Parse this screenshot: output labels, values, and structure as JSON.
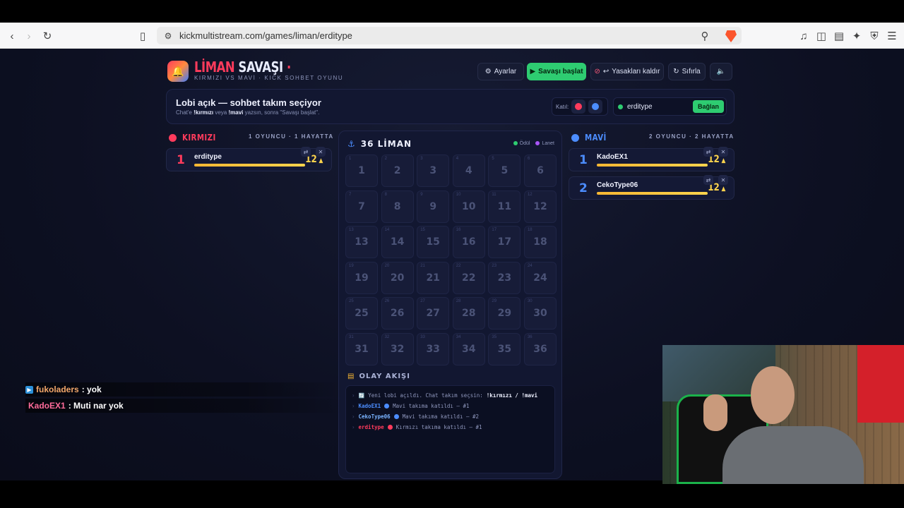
{
  "browser": {
    "url": "kickmultistream.com/games/liman/erditype"
  },
  "header": {
    "logo_red": "LİMAN",
    "logo_white": "SAVAŞI",
    "logo_dot": "·",
    "subtitle": "KIRMIZI VS MAVİ · KICK SOHBET OYUNU",
    "buttons": {
      "settings": "Ayarlar",
      "start": "Savaşı başlat",
      "unban": "Yasakları kaldır",
      "reset": "Sıfırla"
    }
  },
  "lobby": {
    "title": "Lobi açık — sohbet takım seçiyor",
    "sub_prefix": "Chat'e ",
    "sub_red": "!kırmızı",
    "sub_mid": " veya ",
    "sub_blue": "!mavi",
    "sub_suffix": " yazsın, sonra \"Savaşı başlat\".",
    "join_label": "Katıl:",
    "channel": "erditype",
    "connect": "Bağlan"
  },
  "teams": {
    "red": {
      "name": "KIRMIZI",
      "meta": "1 OYUNCU · 1 HAYATTA",
      "color": "#ff3b5c",
      "players": [
        {
          "rank": "1",
          "name": "erditype",
          "lives": "12",
          "life_fraction": 1.0
        }
      ]
    },
    "blue": {
      "name": "MAVİ",
      "meta": "2 OYUNCU · 2 HAYATTA",
      "color": "#4c8dff",
      "players": [
        {
          "rank": "1",
          "name": "KadoEX1",
          "lives": "12",
          "life_fraction": 1.0
        },
        {
          "rank": "2",
          "name": "CekoType06",
          "lives": "12",
          "life_fraction": 1.0
        }
      ]
    }
  },
  "board": {
    "title": "36 LİMAN",
    "legend_reward": "Ödül",
    "legend_curse": "Lanet",
    "cells": [
      "1",
      "2",
      "3",
      "4",
      "5",
      "6",
      "7",
      "8",
      "9",
      "10",
      "11",
      "12",
      "13",
      "14",
      "15",
      "16",
      "17",
      "18",
      "19",
      "20",
      "21",
      "22",
      "23",
      "24",
      "25",
      "26",
      "27",
      "28",
      "29",
      "30",
      "31",
      "32",
      "33",
      "34",
      "35",
      "36"
    ]
  },
  "events": {
    "title": "OLAY AKIŞI",
    "lines": [
      {
        "who": "",
        "text": "Yeni lobi açıldı. Chat takım seçsin: ",
        "cmd": "!kırmızı / !mavi",
        "color": "#8f97bd",
        "dot": ""
      },
      {
        "who": "KadoEX1",
        "text": "Mavi takıma katıldı — #1",
        "cmd": "",
        "color": "#4c8dff",
        "dot": "#4c8dff"
      },
      {
        "who": "CekoType06",
        "text": "Mavi takıma katıldı — #2",
        "cmd": "",
        "color": "#7ab3ff",
        "dot": "#4c8dff"
      },
      {
        "who": "erditype",
        "text": "Kırmızı takıma katıldı — #1",
        "cmd": "",
        "color": "#ff3b5c",
        "dot": "#ff3b5c"
      }
    ]
  },
  "chat": [
    {
      "user": "fukoladers",
      "message": ": yok",
      "color": "#f2a76a"
    },
    {
      "user": "KadoEX1",
      "message": ": Muti nar yok",
      "color": "#ff6b9a"
    }
  ]
}
